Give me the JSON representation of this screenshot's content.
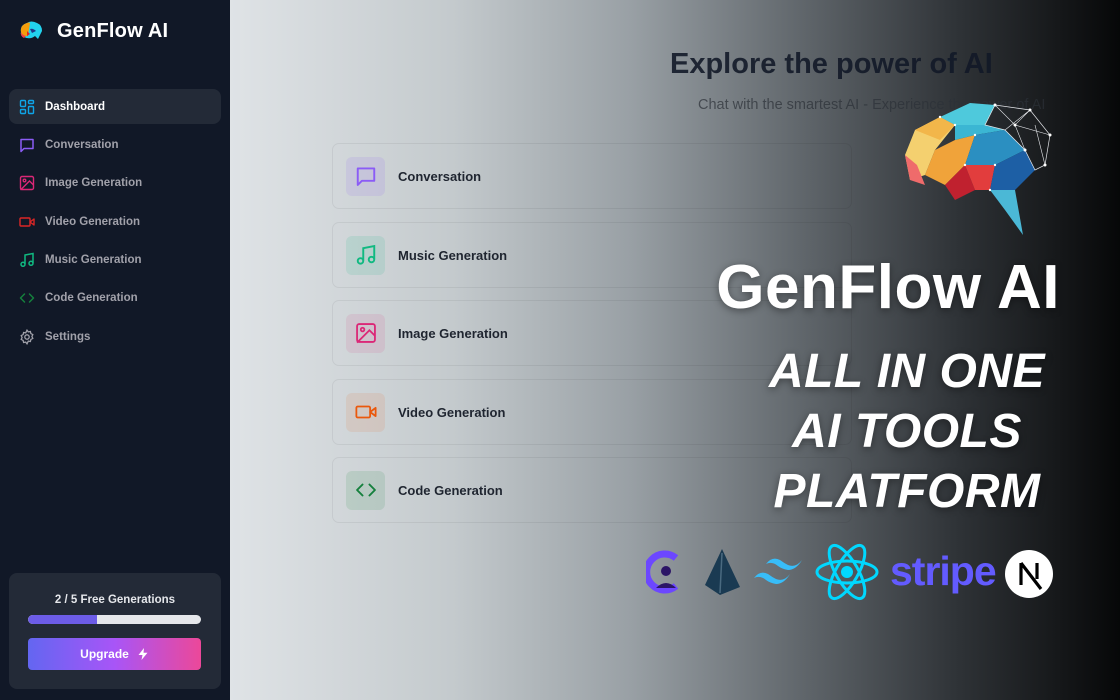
{
  "app": {
    "name": "GenFlow AI",
    "logo_icon": "brain-logo-icon"
  },
  "sidebar": {
    "items": [
      {
        "label": "Dashboard",
        "icon": "dashboard-grid-icon",
        "color": "#0ea5e9",
        "active": true
      },
      {
        "label": "Conversation",
        "icon": "message-square-icon",
        "color": "#8b5cf6",
        "active": false
      },
      {
        "label": "Image Generation",
        "icon": "image-icon",
        "color": "#db2777",
        "active": false
      },
      {
        "label": "Video Generation",
        "icon": "video-icon",
        "color": "#dc2626",
        "active": false
      },
      {
        "label": "Music Generation",
        "icon": "music-icon",
        "color": "#10b981",
        "active": false
      },
      {
        "label": "Code Generation",
        "icon": "code-icon",
        "color": "#15803d",
        "active": false
      },
      {
        "label": "Settings",
        "icon": "settings-gear-icon",
        "color": "#a1a1aa",
        "active": false
      }
    ],
    "usage": {
      "text": "2 / 5 Free Generations",
      "used": 2,
      "limit": 5,
      "progress_fraction": 0.4
    },
    "upgrade_button": {
      "label": "Upgrade",
      "icon": "zap-icon"
    }
  },
  "main": {
    "title": "Explore the power of AI",
    "subtitle": "Chat with the smartest AI - Experience the power of AI",
    "tools": [
      {
        "label": "Conversation",
        "icon": "message-square-icon",
        "color": "#8b5cf6",
        "bg": "#d9d6ec"
      },
      {
        "label": "Music Generation",
        "icon": "music-icon",
        "color": "#10b981",
        "bg": "#c9dbd4"
      },
      {
        "label": "Image Generation",
        "icon": "image-icon",
        "color": "#db2777",
        "bg": "#d9cdd3"
      },
      {
        "label": "Video Generation",
        "icon": "video-icon",
        "color": "#ea580c",
        "bg": "#cfc8c6"
      },
      {
        "label": "Code Generation",
        "icon": "code-icon",
        "color": "#15803d",
        "bg": "#bccdc5"
      }
    ]
  },
  "promo": {
    "title": "GenFlow AI",
    "tagline_lines": [
      "ALL IN ONE",
      "AI TOOLS",
      "PLATFORM"
    ],
    "tech_logos": [
      "clerk-logo-icon",
      "prisma-logo-icon",
      "tailwind-logo-icon",
      "react-logo-icon",
      "stripe-logo",
      "nextjs-logo-icon"
    ],
    "stripe_wordmark": "stripe",
    "nextjs_letter": "N"
  }
}
